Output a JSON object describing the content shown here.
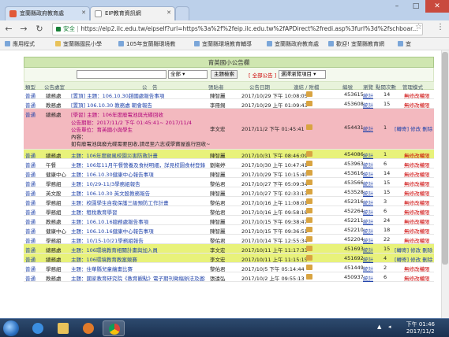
{
  "browser": {
    "tabs": [
      {
        "label": "宜蘭縣政府教育處"
      },
      {
        "label": "EIP教育資訊網"
      }
    ],
    "address": {
      "secure_label": "安全",
      "url": "https://elp2.ilc.edu.tw/eipself?url=https%3a%2f%2feip.ilc.edu.tw%2fAPDirect%2fredi.asp%3furl%3d%2fschboar..."
    },
    "bookmarks": [
      {
        "label": "應用程式"
      },
      {
        "label": "宜蘭縣國民小學"
      },
      {
        "label": "105年宜蘭縣環境教"
      },
      {
        "label": "宜蘭縣環境教育輔導"
      },
      {
        "label": "宜蘭縣政府教育處"
      },
      {
        "label": "歡迎! 宜蘭縣教育網"
      },
      {
        "label": "宜"
      }
    ]
  },
  "board": {
    "title": "育英國小公告欄",
    "filter": {
      "scope_value": "全部",
      "search_button": "主題檢索",
      "all_link": "[ 全部公告 ]",
      "cols_select": "選擇瀏覽項目"
    },
    "headers": {
      "type": "類型",
      "unit": "公告處室",
      "subject": "公　告",
      "publisher": "張貼者",
      "time": "公告日期",
      "attach": "連結 / 附檔",
      "num": "編號",
      "stat": "瀏覽",
      "count": "點閱次數",
      "manage": "管理模式"
    },
    "rows": [
      {
        "type": "普通",
        "unit": "總務處",
        "subject": "[置頂] 主題：106.10.30趙國處報告事項",
        "publisher": "陳智麗",
        "time": "2017/10/29 下午 10:08:05",
        "num": "453615",
        "stat": "統計",
        "count": "14",
        "manage": "無修改權限",
        "style": ""
      },
      {
        "type": "普通",
        "unit": "教務處",
        "subject": "[置頂] 106.10.30 教務處 朝會報告",
        "publisher": "李冊錫",
        "time": "2017/10/29 上午 01:09:43",
        "num": "453608",
        "stat": "統計",
        "count": "15",
        "manage": "無修改權限",
        "style": ""
      },
      {
        "type": "普通",
        "unit": "總務處",
        "subject": "[學習] 主題：106年度廢電池與光碟回收",
        "line2": "公告期限：2017/11/2 下午 01:45:41~ 2017/11/4",
        "line3": "公告單位：育英國小與學生",
        "line4": "內容：",
        "line5": "如有廢電池與廢光碟需要回收,請逕至六志或學寶屋進行回收~",
        "publisher": "李文宏",
        "time": "2017/11/2 下午 01:45:41",
        "num": "454431",
        "stat": "統計",
        "count": "1",
        "manage": "[轉寄] 修改 刪除",
        "style": "tall"
      },
      {
        "type": "普通",
        "unit": "總務處",
        "subject": "主題：106年度颱風校園災害防救計畫",
        "publisher": "陳智麗",
        "time": "2017/10/31 下午 08:46:09",
        "num": "454086",
        "stat": "統計",
        "count": "1",
        "manage": "無修改權限",
        "style": "hl"
      },
      {
        "type": "普通",
        "unit": "午餐",
        "subject": "主題：106年11月午餐營養及食材明細，詳見校園食材登錄平台",
        "publisher": "劉衛婷",
        "time": "2017/10/30 上午 10:47:41",
        "num": "453963",
        "stat": "統計",
        "count": "6",
        "manage": "無修改權限",
        "style": ""
      },
      {
        "type": "普通",
        "unit": "健康中心",
        "subject": "主題：106.10.30健康中心報告事項",
        "publisher": "陳智麗",
        "time": "2017/10/29 下午 10:15:40",
        "num": "453616",
        "stat": "統計",
        "count": "14",
        "manage": "無修改權限",
        "style": ""
      },
      {
        "type": "普通",
        "unit": "學務組",
        "subject": "主題：10/29-11/3學務組報告",
        "publisher": "黎佑君",
        "time": "2017/10/27 下午 05:09:34",
        "num": "453566",
        "stat": "統計",
        "count": "15",
        "manage": "無修改權限",
        "style": ""
      },
      {
        "type": "普通",
        "unit": "英文股",
        "subject": "主題：106.10.30 英文股教務報告",
        "publisher": "陳智麗",
        "time": "2017/10/27 下午 02:33:13",
        "num": "453528",
        "stat": "統計",
        "count": "15",
        "manage": "無修改權限",
        "style": ""
      },
      {
        "type": "普通",
        "unit": "學務組",
        "subject": "主題：校園學生自我保護三級預防工作計畫",
        "publisher": "黎佑君",
        "time": "2017/10/16 上午 11:08:01",
        "num": "452316",
        "stat": "統計",
        "count": "3",
        "manage": "無修改權限",
        "style": ""
      },
      {
        "type": "普通",
        "unit": "學務組",
        "subject": "主題：租稅教育學習",
        "publisher": "黎佑君",
        "time": "2017/10/16 上午 09:58:18",
        "num": "452264",
        "stat": "統計",
        "count": "6",
        "manage": "無修改權限",
        "style": ""
      },
      {
        "type": "普通",
        "unit": "教務處",
        "subject": "主題：106.10.16總務處報告事項",
        "publisher": "陳智麗",
        "time": "2017/10/15 下午 09:38:47",
        "num": "452211",
        "stat": "統計",
        "count": "24",
        "manage": "無修改權限",
        "style": ""
      },
      {
        "type": "普通",
        "unit": "健康中心",
        "subject": "主題：106.10.16健康中心報告事項",
        "publisher": "陳智麗",
        "time": "2017/10/15 下午 09:36:51",
        "num": "452210",
        "stat": "統計",
        "count": "18",
        "manage": "無修改權限",
        "style": ""
      },
      {
        "type": "普通",
        "unit": "學務組",
        "subject": "主題：10/15-10/21學務組報告",
        "publisher": "黎佑君",
        "time": "2017/10/14 下午 12:55:34",
        "num": "452204",
        "stat": "統計",
        "count": "22",
        "manage": "無修改權限",
        "style": ""
      },
      {
        "type": "普通",
        "unit": "總務處",
        "subject": "主題：106環境教育相關計畫與加入員",
        "publisher": "李文宏",
        "time": "2017/10/11 上午 11:17:33",
        "num": "451693",
        "stat": "統計",
        "count": "15",
        "manage": "[轉寄] 修改 刪除",
        "style": "hl"
      },
      {
        "type": "普通",
        "unit": "總務處",
        "subject": "主題：106環境教育教案競賽",
        "publisher": "李文宏",
        "time": "2017/10/11 上午 11:15:15",
        "num": "451692",
        "stat": "統計",
        "count": "4",
        "manage": "[轉寄] 修改 刪除",
        "style": "hl"
      },
      {
        "type": "普通",
        "unit": "學務組",
        "subject": "主題：住華縣兒童繪畫比賽",
        "publisher": "黎佑君",
        "time": "2017/10/5 下午 05:14:44",
        "num": "451449",
        "stat": "統計",
        "count": "2",
        "manage": "無修改權限",
        "style": ""
      },
      {
        "type": "普通",
        "unit": "教務處",
        "subject": "主題：國家教育研究院《教育觀點》電子期刊徵稿辦法及邀稿主題",
        "publisher": "張遠弘",
        "time": "2017/10/2 上午 09:55:13",
        "num": "450937",
        "stat": "統計",
        "count": "6",
        "manage": "無修改權限",
        "style": ""
      }
    ]
  },
  "taskbar": {
    "clock_time": "下午 01:46",
    "clock_date": "2017/11/2"
  }
}
